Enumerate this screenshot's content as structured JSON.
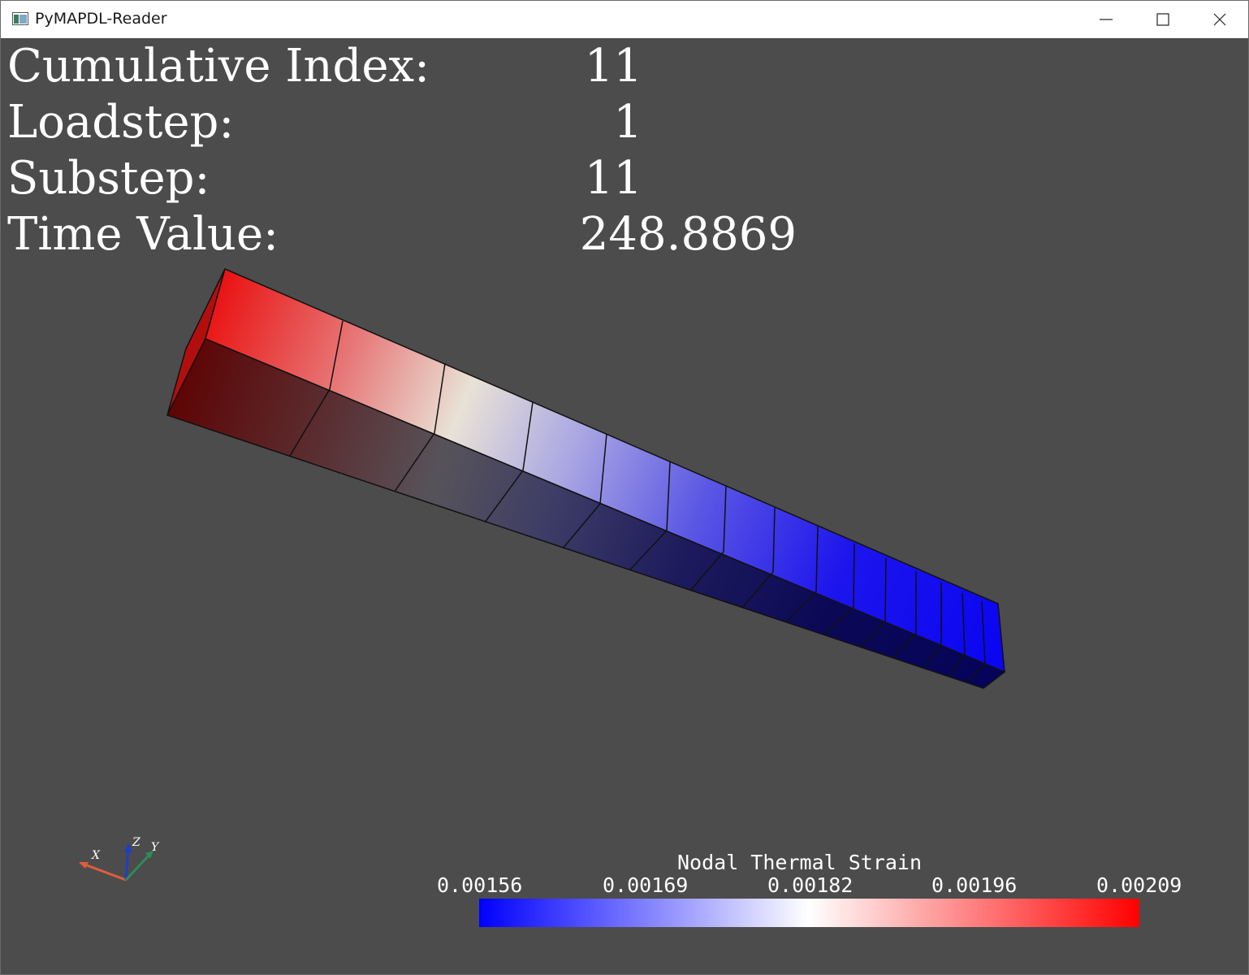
{
  "window": {
    "title": "PyMAPDL-Reader"
  },
  "info": {
    "cumulative_index_label": "Cumulative Index:",
    "cumulative_index_value": "11",
    "loadstep_label": "Loadstep:",
    "loadstep_value": "1",
    "substep_label": "Substep:",
    "substep_value": "11",
    "time_value_label": "Time Value:",
    "time_value_value": "248.8869"
  },
  "scalar_bar": {
    "title": "Nodal Thermal Strain",
    "ticks": [
      "0.00156",
      "0.00169",
      "0.00182",
      "0.00196",
      "0.00209"
    ],
    "colormap": [
      "#0000ff",
      "#ffffff",
      "#ff0000"
    ],
    "min": 0.00156,
    "max": 0.00209
  },
  "axes": {
    "x_label": "X",
    "y_label": "Y",
    "z_label": "Z",
    "colors": {
      "x": "#e05c3a",
      "y": "#2e8b57",
      "z": "#1f3fbf"
    }
  },
  "colors": {
    "background": "#4c4c4c",
    "text": "#ffffff"
  }
}
